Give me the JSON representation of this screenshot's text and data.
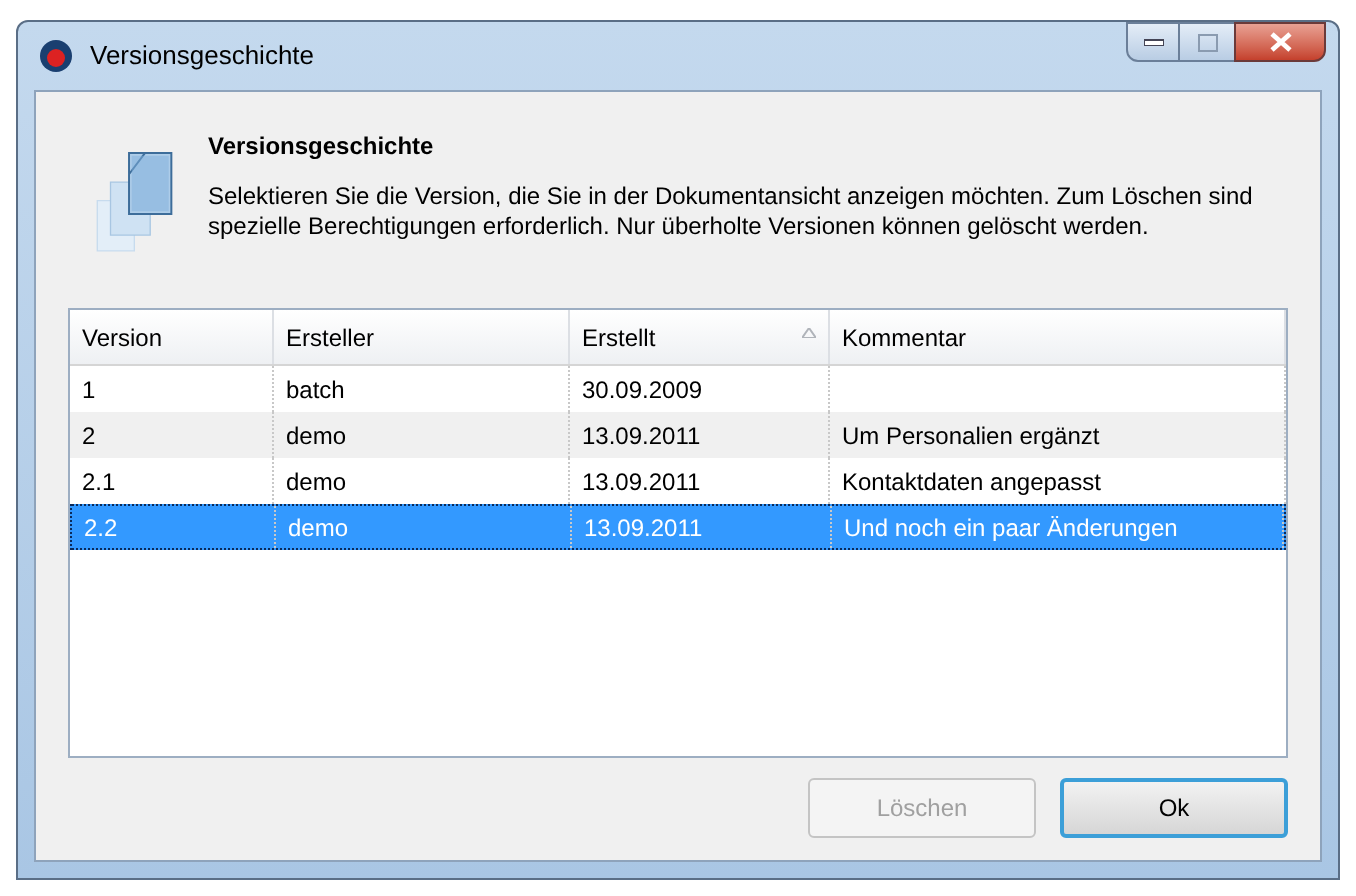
{
  "window": {
    "title": "Versionsgeschichte"
  },
  "header": {
    "title": "Versionsgeschichte",
    "description": "Selektieren Sie die Version, die Sie in der Dokumentansicht anzeigen möchten. Zum Löschen sind spezielle Berechtigungen erforderlich. Nur überholte Versionen können gelöscht werden."
  },
  "table": {
    "columns": [
      {
        "label": "Version",
        "sorted": false
      },
      {
        "label": "Ersteller",
        "sorted": false
      },
      {
        "label": "Erstellt",
        "sorted": true
      },
      {
        "label": "Kommentar",
        "sorted": false
      }
    ],
    "rows": [
      {
        "cells": [
          "1",
          "batch",
          "30.09.2009",
          ""
        ],
        "selected": false
      },
      {
        "cells": [
          "2",
          "demo",
          "13.09.2011",
          "Um Personalien ergänzt"
        ],
        "selected": false
      },
      {
        "cells": [
          "2.1",
          "demo",
          "13.09.2011",
          "Kontaktdaten angepasst"
        ],
        "selected": false
      },
      {
        "cells": [
          "2.2",
          "demo",
          "13.09.2011",
          "Und noch ein paar Änderungen"
        ],
        "selected": true
      }
    ]
  },
  "buttons": [
    {
      "label": "Löschen",
      "disabled": true,
      "default": false
    },
    {
      "label": "Ok",
      "disabled": false,
      "default": true
    }
  ]
}
